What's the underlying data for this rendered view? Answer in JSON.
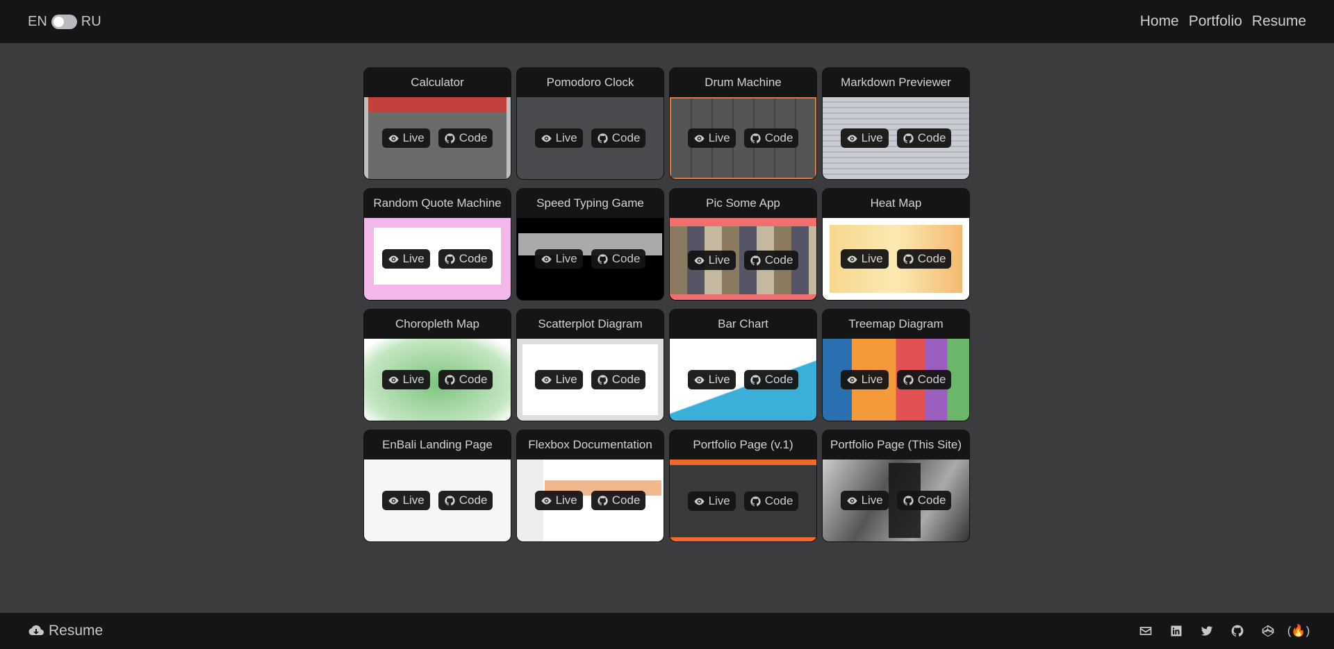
{
  "header": {
    "lang_left": "EN",
    "lang_right": "RU",
    "nav": [
      "Home",
      "Portfolio",
      "Resume"
    ]
  },
  "buttons": {
    "live": "Live",
    "code": "Code"
  },
  "projects": [
    {
      "title": "Calculator"
    },
    {
      "title": "Pomodoro Clock"
    },
    {
      "title": "Drum Machine"
    },
    {
      "title": "Markdown Previewer"
    },
    {
      "title": "Random Quote Machine"
    },
    {
      "title": "Speed Typing Game"
    },
    {
      "title": "Pic Some App"
    },
    {
      "title": "Heat Map"
    },
    {
      "title": "Choropleth Map"
    },
    {
      "title": "Scatterplot Diagram"
    },
    {
      "title": "Bar Chart"
    },
    {
      "title": "Treemap Diagram"
    },
    {
      "title": "EnBali Landing Page"
    },
    {
      "title": "Flexbox Documentation"
    },
    {
      "title": "Portfolio Page (v.1)"
    },
    {
      "title": "Portfolio Page (This Site)"
    }
  ],
  "footer": {
    "resume": "Resume",
    "social": [
      "email-icon",
      "linkedin-icon",
      "twitter-icon",
      "github-icon",
      "codepen-icon",
      "freecodecamp-icon"
    ]
  },
  "colors": {
    "header_bg": "#151515",
    "page_bg": "#3c3c3e"
  }
}
